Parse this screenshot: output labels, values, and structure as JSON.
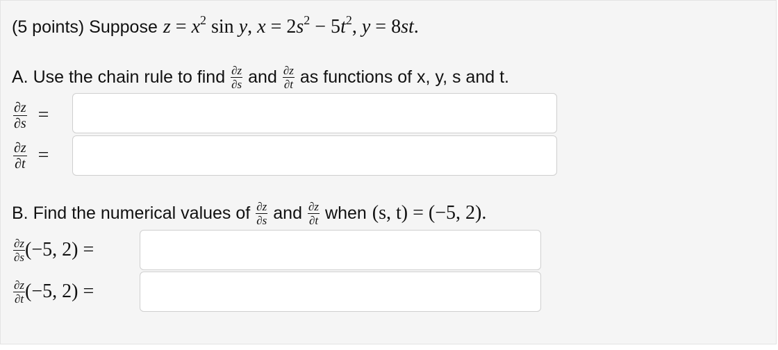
{
  "header": {
    "points": "(5 points) Suppose",
    "math": {
      "z": "z",
      "eq1": " = ",
      "x": "x",
      "sup2": "2",
      "sin": " sin ",
      "y": "y",
      "comma1": ", ",
      "x2": "x",
      "eq2": " = 2",
      "s": "s",
      "sup2b": "2",
      "minus": " − 5",
      "t": "t",
      "sup2c": "2",
      "comma2": ", ",
      "y2": "y",
      "eq3": " = 8",
      "st": "st",
      "dot": "."
    }
  },
  "partA": {
    "intro_prefix": "A. Use the chain rule to find",
    "and": "and",
    "suffix": "as functions of x, y, s and t.",
    "frac_dz": "∂z",
    "frac_ds": "∂s",
    "frac_dt": "∂t",
    "eq": "=",
    "input1_value": "",
    "input2_value": ""
  },
  "partB": {
    "intro_prefix": "B. Find the numerical values of",
    "and": "and",
    "when": "when",
    "cond_math": "(s, t) = (−5, 2).",
    "frac_dz": "∂z",
    "frac_ds": "∂s",
    "frac_dt": "∂t",
    "point_label": "(−5, 2) =",
    "input3_value": "",
    "input4_value": ""
  }
}
